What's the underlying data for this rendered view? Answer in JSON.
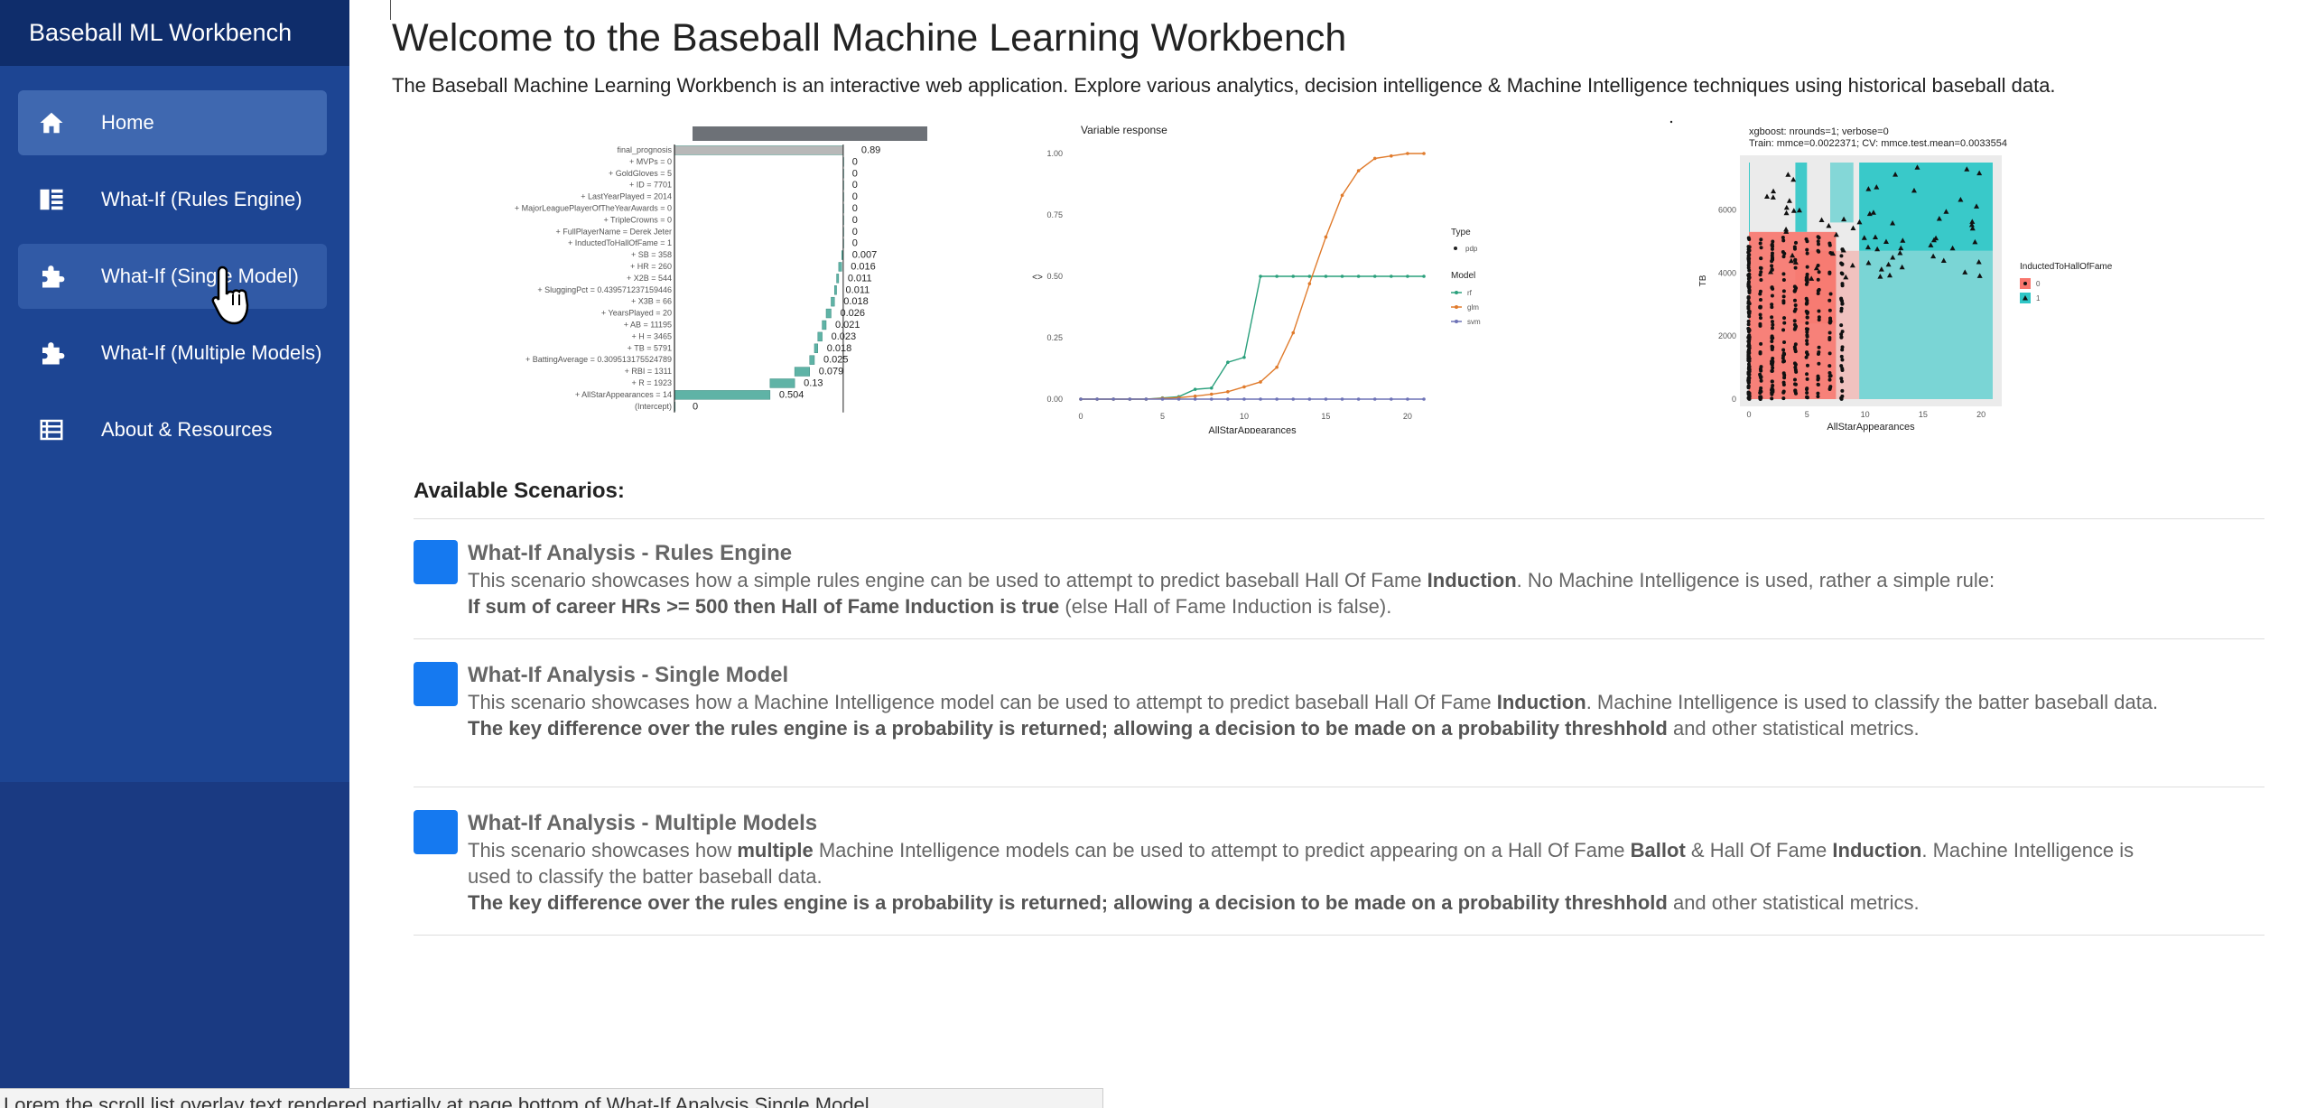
{
  "app": {
    "brand": "Baseball ML Workbench"
  },
  "sidebar": {
    "items": [
      {
        "label": "Home",
        "icon": "home-icon"
      },
      {
        "label": "What-If (Rules Engine)",
        "icon": "rules-icon"
      },
      {
        "label": "What-If (Single Model)",
        "icon": "puzzle-icon"
      },
      {
        "label": "What-If (Multiple Models)",
        "icon": "puzzle-icon"
      },
      {
        "label": "About & Resources",
        "icon": "list-icon"
      }
    ]
  },
  "main": {
    "title": "Welcome to the Baseball Machine Learning Workbench",
    "intro": "The Baseball Machine Learning Workbench is an interactive web application. Explore various analytics, decision intelligence & Machine Intelligence techniques using historical baseball data.",
    "scenarios_heading": "Available Scenarios:",
    "scenarios": [
      {
        "title": "What-If Analysis - Rules Engine",
        "line1_a": "This scenario showcases how a simple rules engine can be used to attempt to predict baseball Hall Of Fame ",
        "line1_b": "Induction",
        "line1_c": ". No Machine Intelligence is used, rather a simple rule:",
        "line2_a": "If sum of career HRs >= 500 then Hall of Fame Induction is true",
        "line2_b": " (else Hall of Fame Induction is false)."
      },
      {
        "title": "What-If Analysis - Single Model",
        "line1_a": "This scenario showcases how a Machine Intelligence model can be used to attempt to predict baseball Hall Of Fame ",
        "line1_b": "Induction",
        "line1_c": ". Machine Intelligence is used to classify the batter baseball data.",
        "line2_a": "The key difference over the rules engine is a probability is returned; allowing a decision to be made on a probability threshhold",
        "line2_b": " and other statistical metrics."
      },
      {
        "title": "What-If Analysis - Multiple Models",
        "line1_a": "This scenario showcases how ",
        "line1_b": "multiple",
        "line1_c": " Machine Intelligence models can be used to attempt to predict appearing on a Hall Of Fame ",
        "line1_d": "Ballot",
        "line1_e": " & Hall Of Fame ",
        "line1_f": "Induction",
        "line1_g": ". Machine Intelligence is used to classify the batter baseball data.",
        "line2_a": "The key difference over the rules engine is a probability is returned; allowing a decision to be made on a probability threshhold",
        "line2_b": " and other statistical metrics."
      }
    ]
  },
  "figures": {
    "breakdown": {
      "labels": [
        "final_prognosis",
        "+ MVPs = 0",
        "+ GoldGloves = 5",
        "+ ID = 7701",
        "+ LastYearPlayed = 2014",
        "+ MajorLeaguePlayerOfTheYearAwards = 0",
        "+ TripleCrowns = 0",
        "+ FullPlayerName = Derek Jeter",
        "+ InductedToHallOfFame = 1",
        "+ SB = 358",
        "+ HR = 260",
        "+ X2B = 544",
        "+ SluggingPct = 0.439571237159446",
        "+ X3B = 66",
        "+ YearsPlayed = 20",
        "+ AB = 11195",
        "+ H = 3465",
        "+ TB = 5791",
        "+ BattingAverage = 0.309513175524789",
        "+ RBI = 1311",
        "+ R = 1923",
        "+ AllStarAppearances = 14",
        "(Intercept)"
      ],
      "values": [
        "0.89",
        "0",
        "0",
        "0",
        "0",
        "0",
        "0",
        "0",
        "0",
        "0.007",
        "0.016",
        "0.011",
        "0.011",
        "0.018",
        "0.026",
        "0.021",
        "0.023",
        "0.018",
        "0.025",
        "0.079",
        "0.13",
        "0.504",
        "0"
      ],
      "axis_ticks": [
        "0.0",
        "0.4",
        "0.8"
      ]
    },
    "pdp": {
      "title": "Variable response",
      "xlabel": "AllStarAppearances",
      "ylabel": "<>",
      "yticks": [
        "0.00",
        "0.25",
        "0.50",
        "0.75",
        "1.00"
      ],
      "xticks": [
        "0",
        "5",
        "10",
        "15",
        "20"
      ],
      "legend_type_title": "Type",
      "legend_type_items": [
        "pdp"
      ],
      "legend_model_title": "Model",
      "legend_model_items": [
        "rf",
        "glm",
        "svm"
      ],
      "colors": {
        "rf": "#2aa07c",
        "glm": "#e07b2c",
        "svm": "#6d72b6"
      }
    },
    "xgb": {
      "title_line1": "xgboost: nrounds=1; verbose=0",
      "title_line2": "Train: mmce=0.0022371; CV: mmce.test.mean=0.0033554",
      "xlabel": "AllStarAppearances",
      "ylabel": "TB",
      "xticks": [
        "0",
        "5",
        "10",
        "15",
        "20"
      ],
      "yticks": [
        "0",
        "2000",
        "4000",
        "6000"
      ],
      "legend_title": "InductedToHallOfFame",
      "legend_items": [
        "0",
        "1"
      ],
      "colors": {
        "class0": "#f8766d",
        "class1": "#2fc7c7"
      }
    }
  },
  "status": {
    "bottom_text": "Lorem the scroll list overlay text rendered partially at page bottom of What-If Analysis Single Model"
  }
}
